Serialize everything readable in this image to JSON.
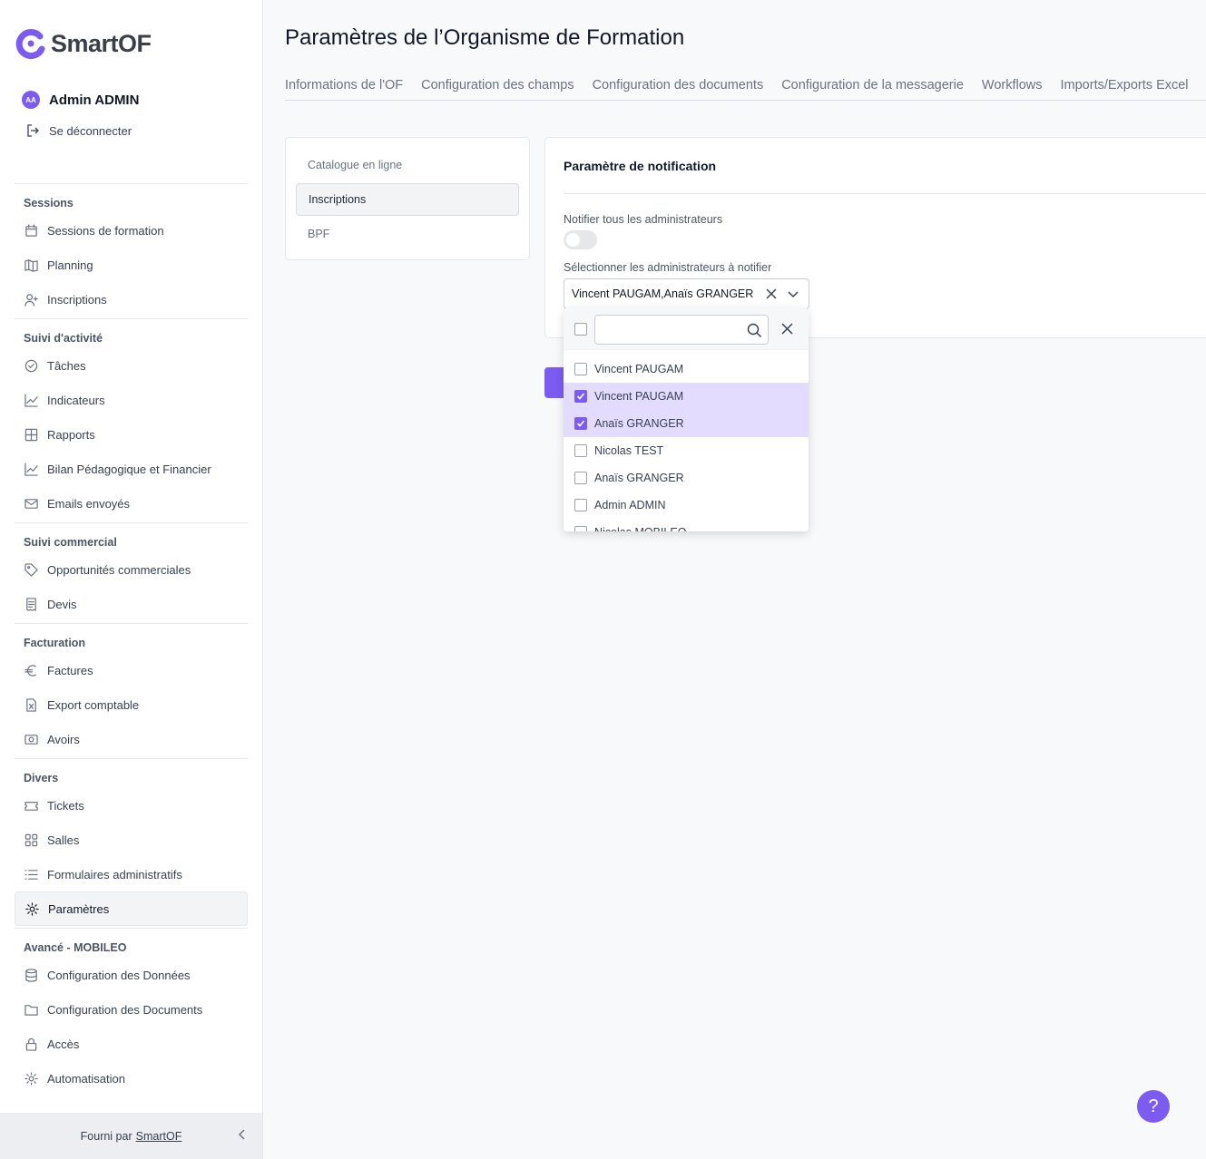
{
  "brand": {
    "name": "SmartOF",
    "accent": "#7c5cf0"
  },
  "user": {
    "initials": "AA",
    "name": "Admin ADMIN",
    "logout_label": "Se déconnecter"
  },
  "sidebar": {
    "groups": [
      {
        "title": "Sessions",
        "items": [
          {
            "label": "Sessions de formation",
            "icon": "calendar-icon"
          },
          {
            "label": "Planning",
            "icon": "map-icon"
          },
          {
            "label": "Inscriptions",
            "icon": "user-plus-icon"
          }
        ]
      },
      {
        "title": "Suivi d'activité",
        "items": [
          {
            "label": "Tâches",
            "icon": "check-circle-icon"
          },
          {
            "label": "Indicateurs",
            "icon": "chart-line-icon"
          },
          {
            "label": "Rapports",
            "icon": "grid-icon"
          },
          {
            "label": "Bilan Pédagogique et Financier",
            "icon": "chart-line-icon"
          },
          {
            "label": "Emails envoyés",
            "icon": "mail-icon"
          }
        ]
      },
      {
        "title": "Suivi commercial",
        "items": [
          {
            "label": "Opportunités commerciales",
            "icon": "tag-icon"
          },
          {
            "label": "Devis",
            "icon": "receipt-icon"
          }
        ]
      },
      {
        "title": "Facturation",
        "items": [
          {
            "label": "Factures",
            "icon": "euro-icon"
          },
          {
            "label": "Export comptable",
            "icon": "file-excel-icon"
          },
          {
            "label": "Avoirs",
            "icon": "banknote-icon"
          }
        ]
      },
      {
        "title": "Divers",
        "items": [
          {
            "label": "Tickets",
            "icon": "ticket-icon"
          },
          {
            "label": "Salles",
            "icon": "apps-icon"
          },
          {
            "label": "Formulaires administratifs",
            "icon": "list-icon"
          },
          {
            "label": "Paramètres",
            "icon": "gear-icon",
            "active": true
          }
        ]
      },
      {
        "title": "Avancé - MOBILEO",
        "items": [
          {
            "label": "Configuration des Données",
            "icon": "database-icon"
          },
          {
            "label": "Configuration des Documents",
            "icon": "folder-icon"
          },
          {
            "label": "Accès",
            "icon": "lock-icon"
          },
          {
            "label": "Automatisation",
            "icon": "gear-icon"
          }
        ]
      }
    ],
    "footer": {
      "prefix": "Fourni par",
      "link": "SmartOF"
    }
  },
  "page": {
    "title": "Paramètres de l’Organisme de Formation",
    "tabs": [
      "Informations de l'OF",
      "Configuration des champs",
      "Configuration des documents",
      "Configuration de la messagerie",
      "Workflows",
      "Imports/Exports Excel"
    ],
    "sub_nav": [
      {
        "label": "Catalogue en ligne"
      },
      {
        "label": "Inscriptions",
        "active": true
      },
      {
        "label": "BPF"
      }
    ],
    "panel": {
      "title": "Paramètre de notification",
      "notify_all_label": "Notifier tous les administrateurs",
      "notify_all_on": false,
      "select_label": "Sélectionner les administrateurs à notifier",
      "select_value": "Vincent PAUGAM,Anaïs GRANGER"
    },
    "dropdown": {
      "search_value": "",
      "options": [
        {
          "label": "Vincent PAUGAM",
          "checked": false
        },
        {
          "label": "Vincent PAUGAM",
          "checked": true
        },
        {
          "label": "Anaïs GRANGER",
          "checked": true
        },
        {
          "label": "Nicolas TEST",
          "checked": false
        },
        {
          "label": "Anaïs GRANGER",
          "checked": false
        },
        {
          "label": "Admin ADMIN",
          "checked": false
        },
        {
          "label": "Nicolas MOBILEO",
          "checked": false
        }
      ]
    },
    "help_label": "?"
  }
}
